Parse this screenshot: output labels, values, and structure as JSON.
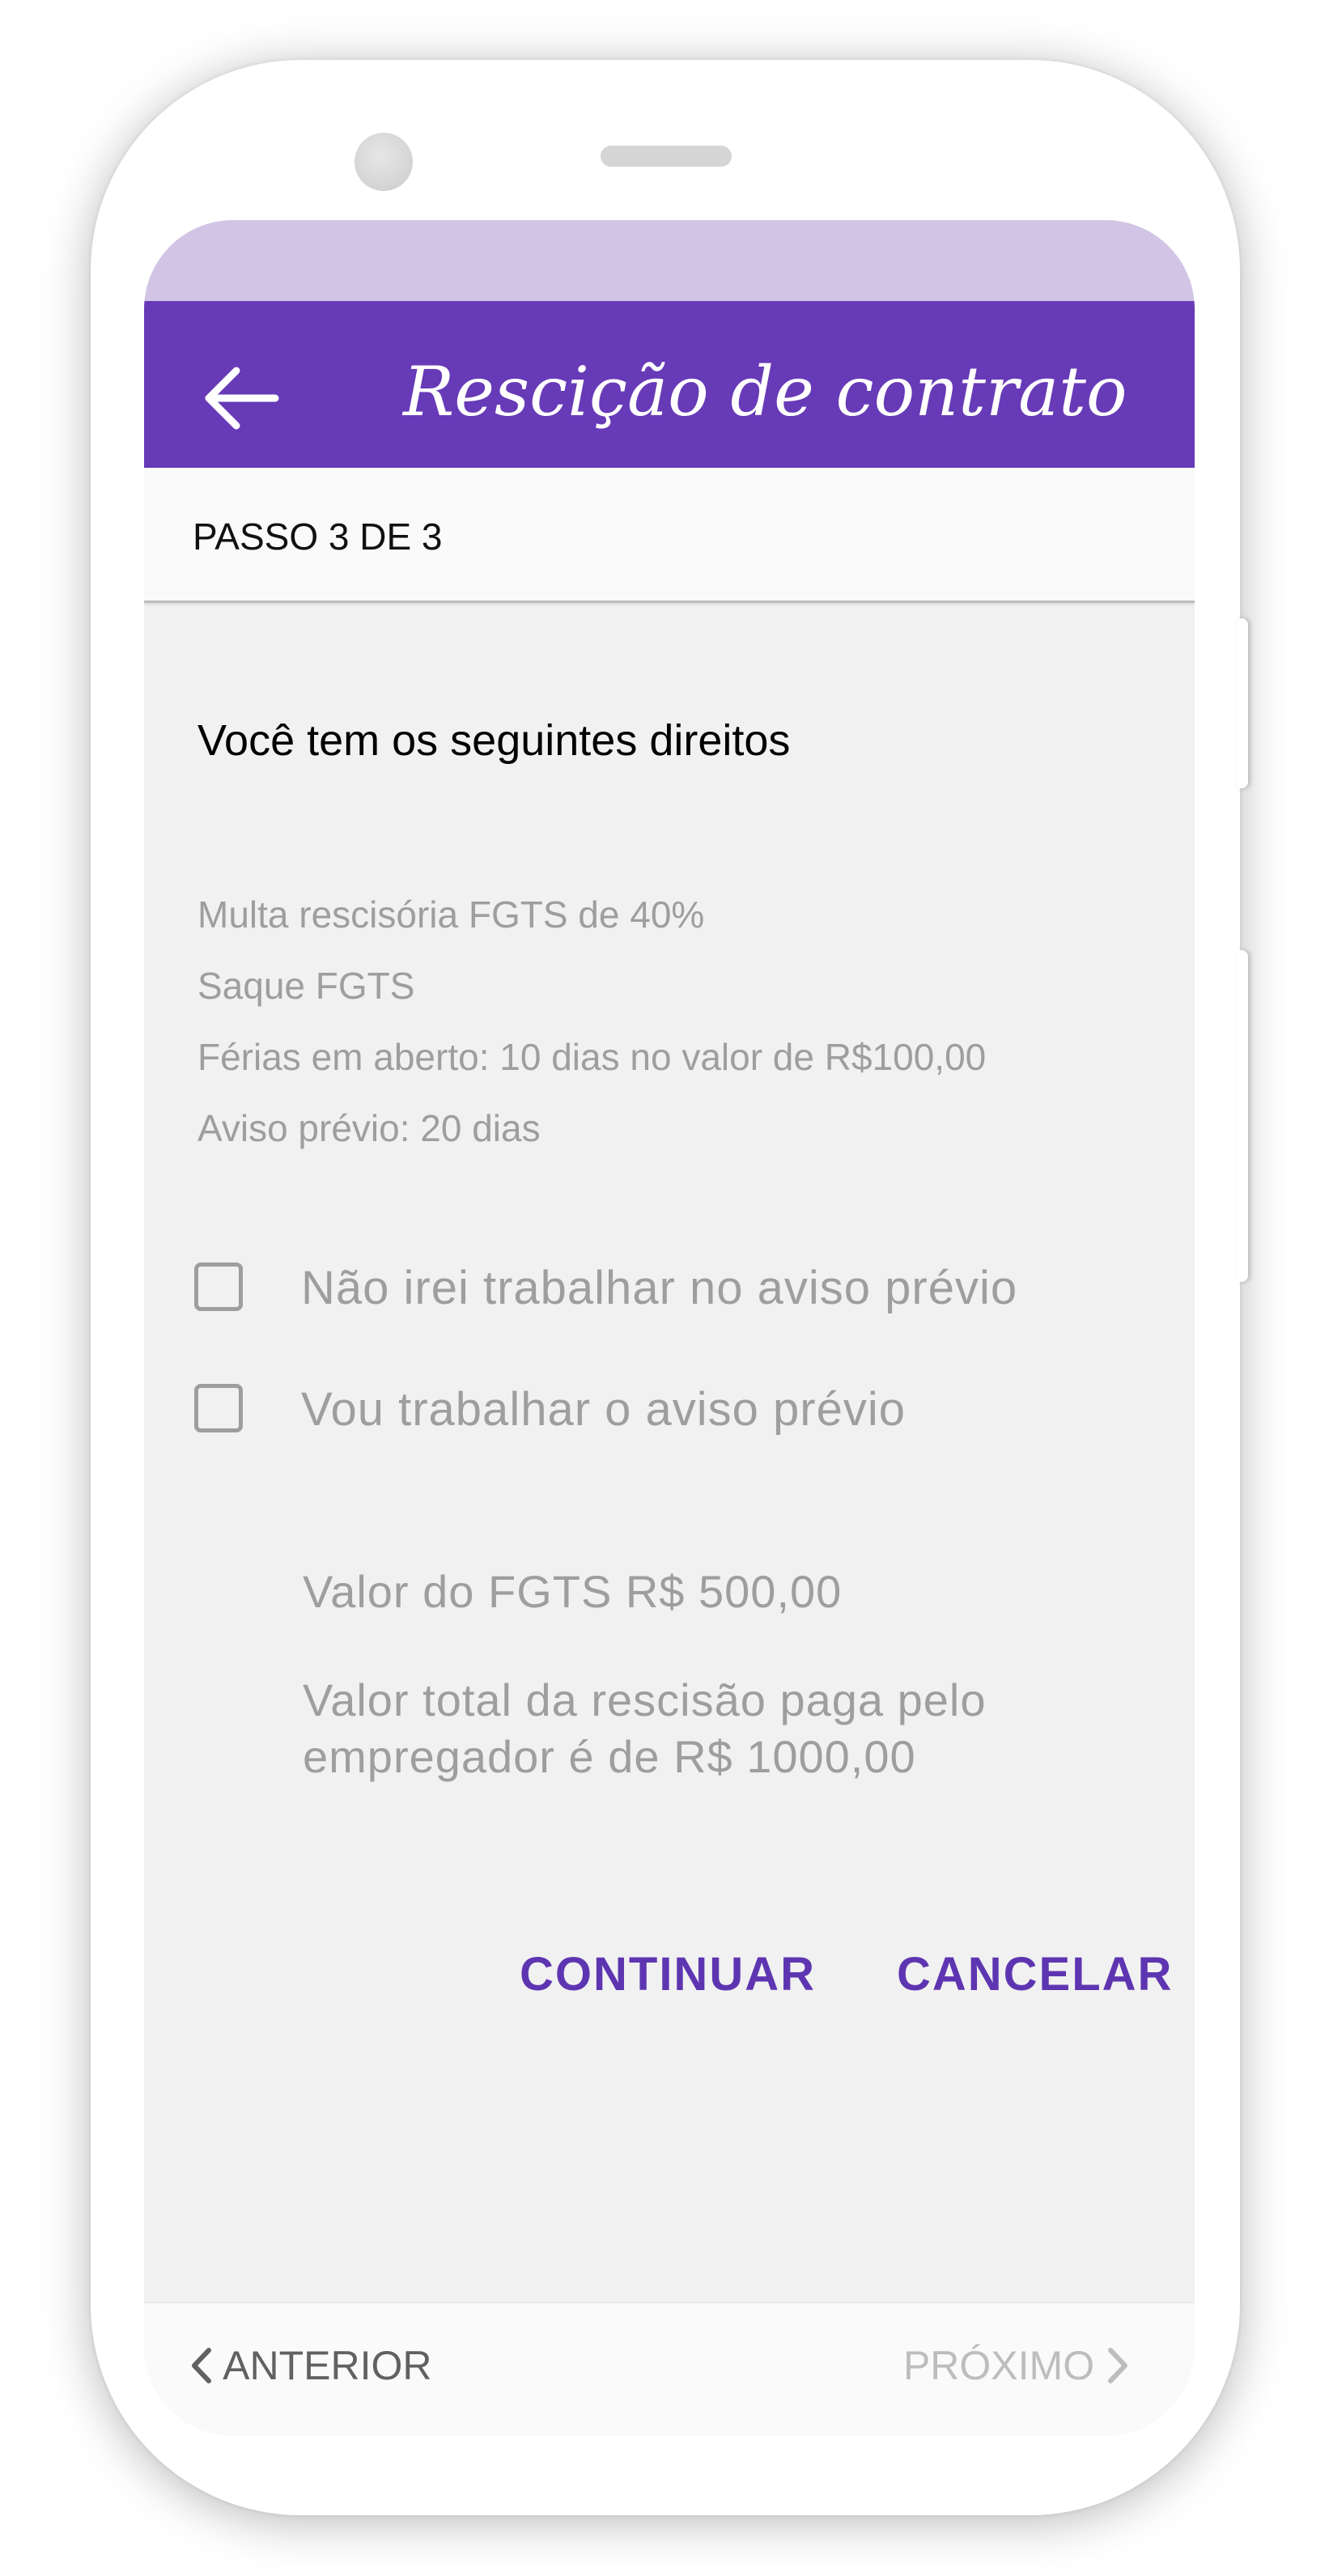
{
  "app_bar": {
    "title": "Rescição de contrato",
    "back_icon": "arrow-left-icon",
    "color": "#673ab7",
    "status_strip_color": "#d1c4e4"
  },
  "step": {
    "label": "PASSO 3 DE 3"
  },
  "rights": {
    "title": "Você tem os seguintes direitos",
    "items": [
      "Multa rescisória FGTS de 40%",
      "Saque FGTS",
      "Férias em aberto: 10 dias no valor de R$100,00",
      "Aviso prévio: 20 dias"
    ]
  },
  "options": [
    {
      "label": "Não irei trabalhar no aviso prévio",
      "checked": false
    },
    {
      "label": "Vou trabalhar o aviso prévio",
      "checked": false
    }
  ],
  "summary": {
    "fgts_value": "Valor do FGTS R$ 500,00",
    "total_value": "Valor total da rescisão paga pelo empregador é de R$ 1000,00"
  },
  "actions": {
    "continue_label": "CONTINUAR",
    "cancel_label": "CANCELAR",
    "accent": "#5e35b1"
  },
  "navigation": {
    "prev_label": "ANTERIOR",
    "next_label": "PRÓXIMO",
    "prev_icon": "chevron-left-icon",
    "next_icon": "chevron-right-icon",
    "next_disabled": true
  }
}
